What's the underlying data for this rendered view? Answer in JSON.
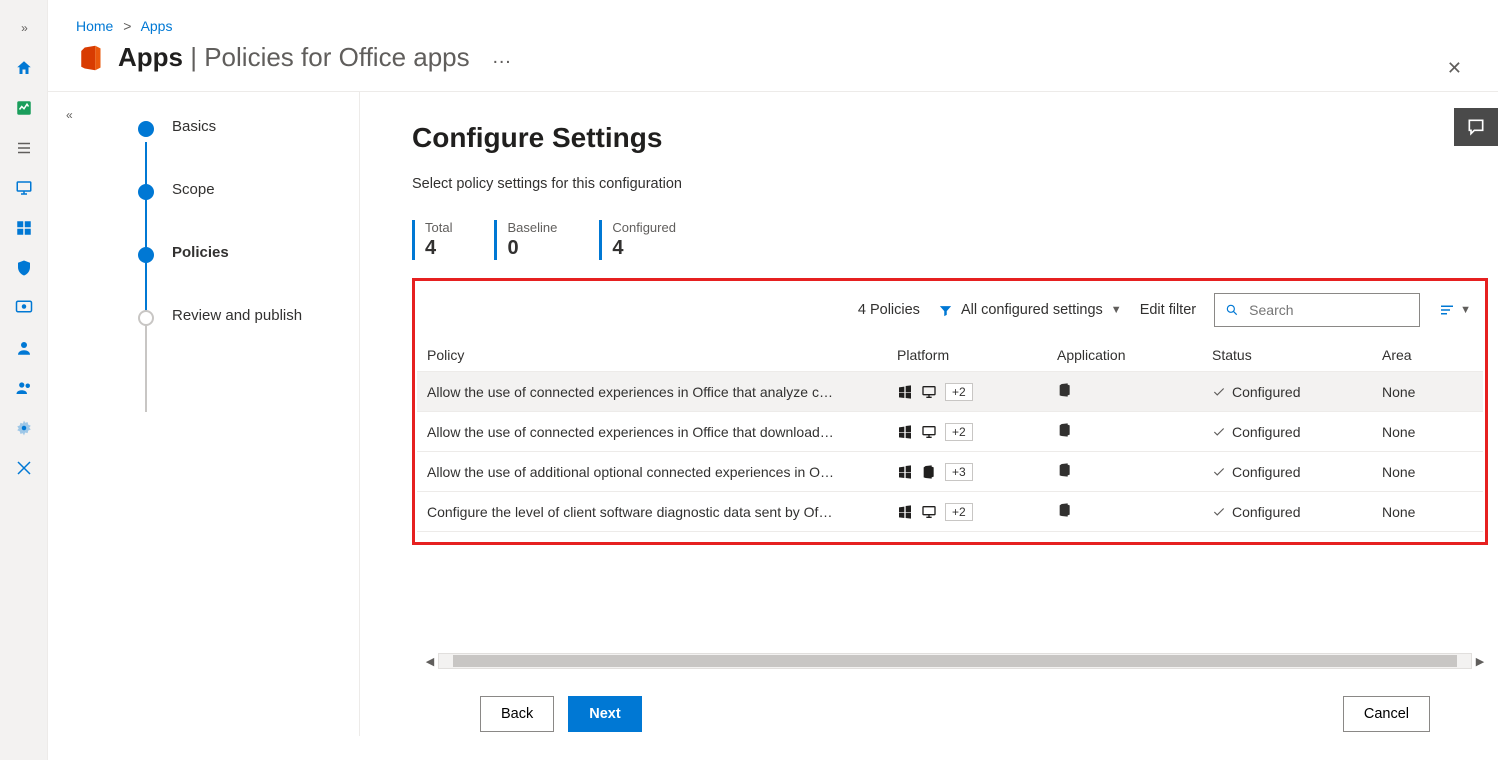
{
  "breadcrumb": {
    "home": "Home",
    "apps": "Apps"
  },
  "header": {
    "title_bold": "Apps",
    "title_rest": "Policies for Office apps"
  },
  "stepper": {
    "basics": "Basics",
    "scope": "Scope",
    "policies": "Policies",
    "review": "Review and publish"
  },
  "content": {
    "heading": "Configure Settings",
    "subtext": "Select policy settings for this configuration",
    "counters": {
      "total_label": "Total",
      "total_value": "4",
      "baseline_label": "Baseline",
      "baseline_value": "0",
      "configured_label": "Configured",
      "configured_value": "4"
    },
    "toolbar": {
      "count": "4 Policies",
      "filter_label": "All configured settings",
      "edit_filter": "Edit filter",
      "search_placeholder": "Search"
    },
    "columns": {
      "policy": "Policy",
      "platform": "Platform",
      "application": "Application",
      "status": "Status",
      "area": "Area"
    },
    "rows": [
      {
        "name": "Allow the use of connected experiences in Office that analyze c…",
        "plus": "+2",
        "plat2": "monitor",
        "status": "Configured",
        "area": "None"
      },
      {
        "name": "Allow the use of connected experiences in Office that download…",
        "plus": "+2",
        "plat2": "monitor",
        "status": "Configured",
        "area": "None"
      },
      {
        "name": "Allow the use of additional optional connected experiences in O…",
        "plus": "+3",
        "plat2": "office",
        "status": "Configured",
        "area": "None"
      },
      {
        "name": "Configure the level of client software diagnostic data sent by Of…",
        "plus": "+2",
        "plat2": "monitor",
        "status": "Configured",
        "area": "None"
      }
    ]
  },
  "footer": {
    "back": "Back",
    "next": "Next",
    "cancel": "Cancel"
  }
}
